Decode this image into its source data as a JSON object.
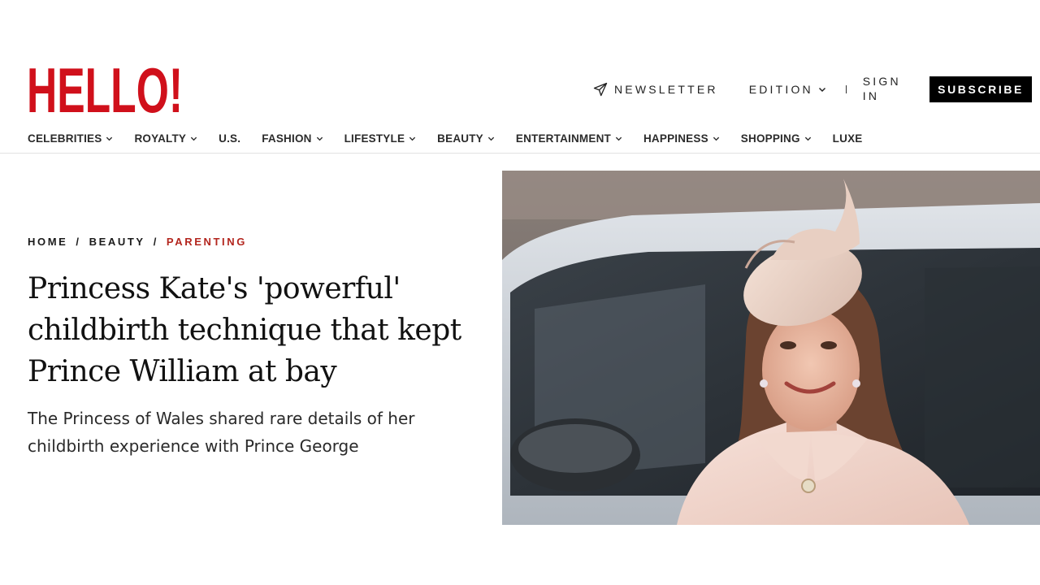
{
  "brand": {
    "logo_text": "HELLO!",
    "color": "#d0101b"
  },
  "top_actions": {
    "newsletter": "NEWSLETTER",
    "edition": "EDITION",
    "sign_in": "SIGN IN",
    "subscribe": "SUBSCRIBE"
  },
  "nav": [
    {
      "label": "CELEBRITIES",
      "dropdown": true
    },
    {
      "label": "ROYALTY",
      "dropdown": true
    },
    {
      "label": "U.S.",
      "dropdown": false
    },
    {
      "label": "FASHION",
      "dropdown": true
    },
    {
      "label": "LIFESTYLE",
      "dropdown": true
    },
    {
      "label": "BEAUTY",
      "dropdown": true
    },
    {
      "label": "ENTERTAINMENT",
      "dropdown": true
    },
    {
      "label": "HAPPINESS",
      "dropdown": true
    },
    {
      "label": "SHOPPING",
      "dropdown": true
    },
    {
      "label": "LUXE",
      "dropdown": false
    }
  ],
  "article": {
    "breadcrumb": [
      "HOME",
      "BEAUTY",
      "PARENTING"
    ],
    "headline": "Princess Kate's 'powerful' childbirth technique that kept Prince William at bay",
    "standfirst": "The Princess of Wales shared rare details of her childbirth experience with Prince George"
  },
  "icons": {
    "newsletter": "paper-plane-icon",
    "dropdown": "chevron-down-icon"
  },
  "colors": {
    "accent": "#b3261e",
    "text": "#1a1a1a",
    "subscribe_bg": "#000000"
  }
}
